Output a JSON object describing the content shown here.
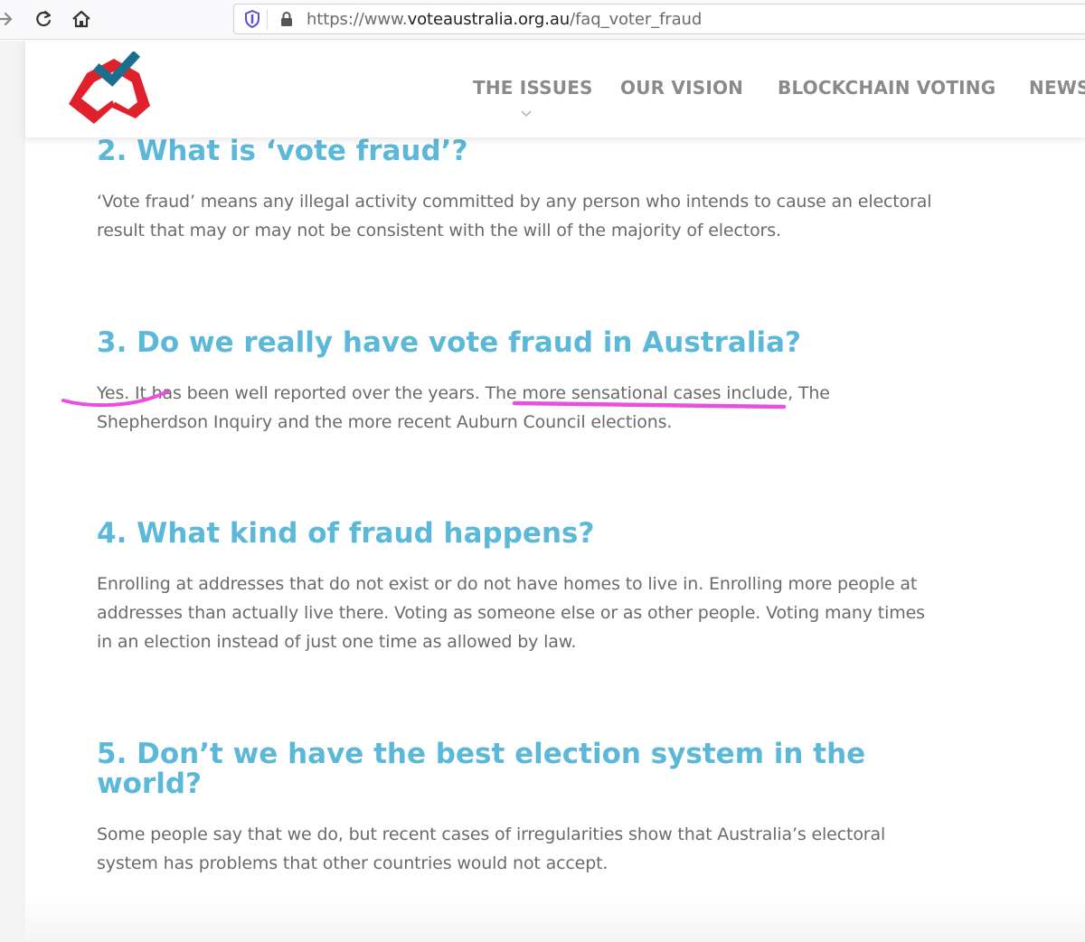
{
  "browser": {
    "url_prefix": "https://www.",
    "url_domain": "voteaustralia.org.au",
    "url_path": "/faq_voter_fraud"
  },
  "nav": {
    "items": [
      "THE ISSUES",
      "OUR VISION",
      "BLOCKCHAIN VOTING",
      "NEWS"
    ]
  },
  "faq": [
    {
      "question": "2. What is ‘vote fraud’?",
      "answer_lines": [
        "‘Vote fraud’ means any illegal activity committed by any person who intends to cause an electoral",
        "result that may or may not be consistent with the will of the majority of electors."
      ]
    },
    {
      "question": "3. Do we really have vote fraud in Australia?",
      "answer_lines": [
        "Yes. It has been well reported over the years. The more sensational cases include, The",
        "Shepherdson Inquiry and the more recent Auburn Council elections."
      ]
    },
    {
      "question": "4. What kind of fraud happens?",
      "answer_lines": [
        "Enrolling at addresses that do not exist or do not have homes to live in. Enrolling more people at",
        "addresses than actually live there. Voting as someone else or as other people. Voting many times",
        "in an election instead of just one time as allowed by law."
      ]
    },
    {
      "question_lines": [
        "5. Don’t we have the best election system in the",
        "world?"
      ],
      "answer_lines": [
        "Some people say that we do, but recent cases of irregularities show that Australia’s electoral",
        "system has problems that other countries would not accept."
      ]
    }
  ],
  "colors": {
    "heading": "#5cb8d9",
    "body_text": "#6a6a6a",
    "nav_text": "#8a8a8a",
    "annotation": "#e84fe0",
    "logo_red": "#e0202a",
    "logo_blue": "#1b6e8e"
  },
  "icons": [
    "forward-arrow-icon",
    "reload-icon",
    "home-icon",
    "tracking-shield-icon",
    "lock-icon",
    "chevron-down-icon"
  ]
}
